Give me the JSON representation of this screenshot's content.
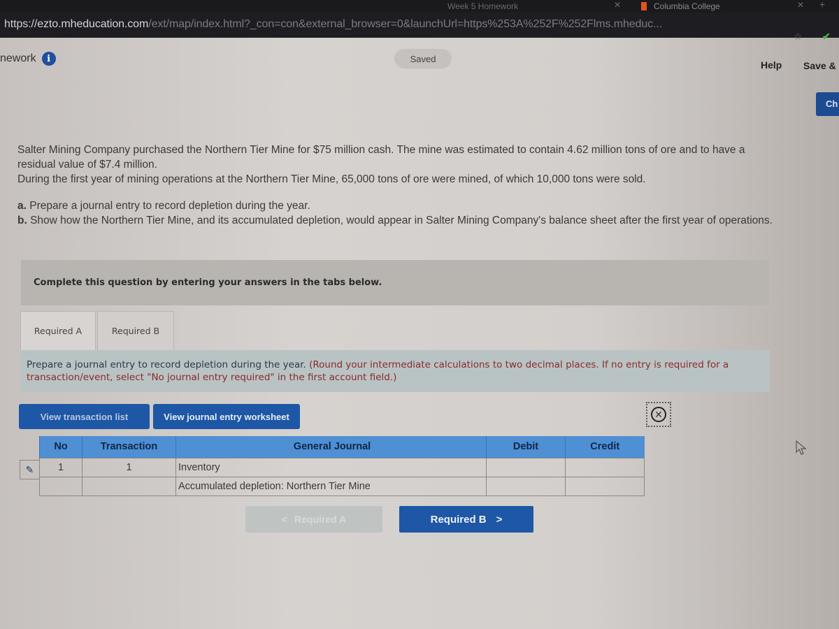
{
  "browser": {
    "tabs": [
      {
        "label": "Week 5 Homework",
        "active": false
      },
      {
        "label": "Columbia College",
        "active": true
      }
    ],
    "url": {
      "scheme": "https://",
      "host": "ezto.mheducation.com",
      "path": "/ext/map/index.html?_con=con&external_browser=0&launchUrl=https%253A%252F%252Flms.mheduc..."
    },
    "icons": {
      "close_tab": "✕",
      "close_window": "✕",
      "new_tab": "+",
      "bookmark": "☆",
      "extension": "✔"
    }
  },
  "header": {
    "title": "nework",
    "info_icon": "i",
    "saved_label": "Saved",
    "help_label": "Help",
    "save_exit_label": "Save &",
    "check_label": "Ch"
  },
  "question": {
    "line1": "Salter Mining Company purchased the Northern Tier Mine for $75 million cash. The mine was estimated to contain 4.62 million tons of ore and to have a residual value of $7.4 million.",
    "line2": "During the first year of mining operations at the Northern Tier Mine, 65,000 tons of ore were mined, of which 10,000 tons were sold.",
    "parts": [
      {
        "label": "a.",
        "text": " Prepare a journal entry to record depletion during the year."
      },
      {
        "label": "b.",
        "text": " Show how the Northern Tier Mine, and its accumulated depletion, would appear in Salter Mining Company's balance sheet after the first year of operations."
      }
    ]
  },
  "banner": {
    "text": "Complete this question by entering your answers in the tabs below."
  },
  "tabs": [
    {
      "label": "Required A",
      "active": true
    },
    {
      "label": "Required B",
      "active": false
    }
  ],
  "panel": {
    "instruction": "Prepare a journal entry to record depletion during the year. ",
    "note": "(Round your intermediate calculations to two decimal places. If no entry is required for a transaction/event, select \"No journal entry required\" in the first account field.)",
    "view_transaction_list": "View transaction list",
    "view_journal_worksheet": "View journal entry worksheet",
    "close_icon": "✕"
  },
  "journal": {
    "headers": [
      "No",
      "Transaction",
      "General Journal",
      "Debit",
      "Credit"
    ],
    "rows": [
      {
        "no": "1",
        "transaction": "1",
        "account": "Inventory",
        "debit": "",
        "credit": ""
      },
      {
        "no": "",
        "transaction": "",
        "account": "Accumulated depletion: Northern Tier Mine",
        "debit": "",
        "credit": ""
      }
    ],
    "edit_icon": "✎"
  },
  "nav": {
    "prev_label": "Required A",
    "prev_arrow": "<",
    "next_label": "Required B",
    "next_arrow": ">"
  },
  "colors": {
    "primary_blue": "#1d57a5",
    "table_header": "#4f8fd4",
    "note_red": "#8c2a28",
    "info_blue": "#1f4f9f"
  }
}
